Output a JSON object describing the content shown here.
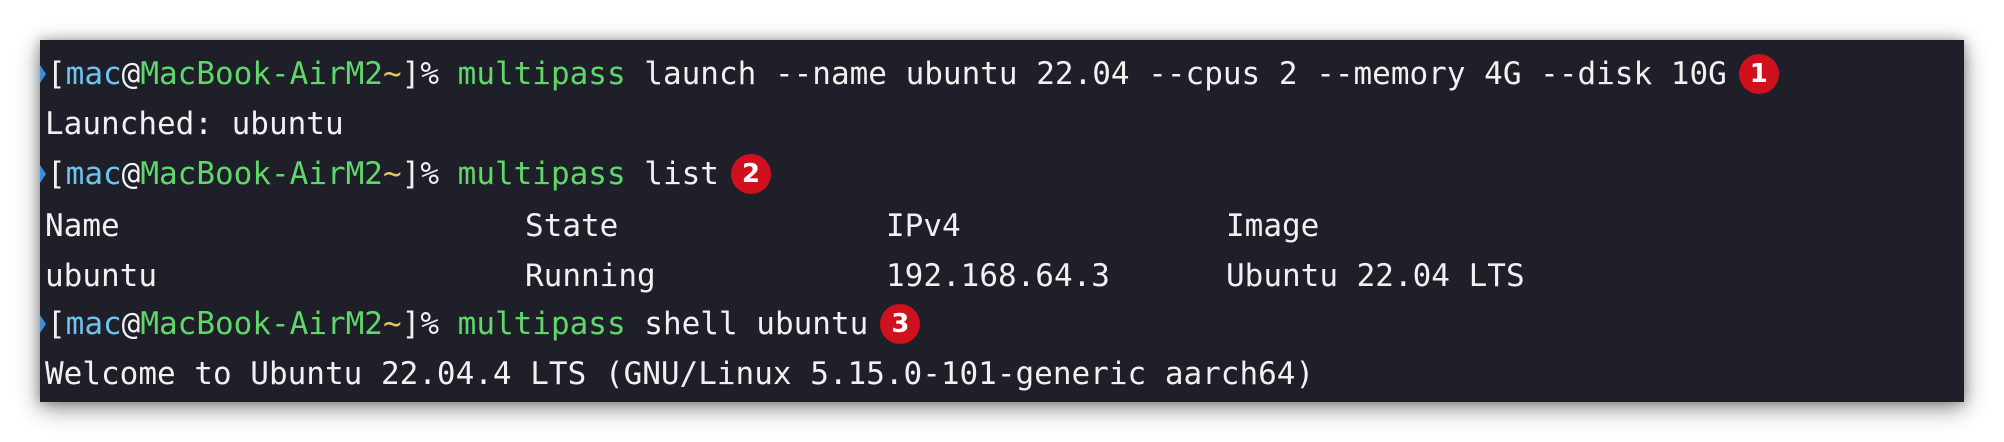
{
  "prompt": {
    "open_bracket": "[",
    "user": "mac",
    "at": "@",
    "host": "MacBook-AirM2",
    "tilde": "~",
    "close_bracket": "]",
    "symbol": "% "
  },
  "commands": [
    {
      "program": "multipass",
      "args": " launch --name ubuntu 22.04 --cpus 2 --memory 4G --disk 10G",
      "step": "1"
    },
    {
      "program": "multipass",
      "args": " list",
      "step": "2"
    },
    {
      "program": "multipass",
      "args": " shell ubuntu",
      "step": "3"
    }
  ],
  "outputs": {
    "launch": "Launched: ubuntu",
    "welcome": "Welcome to Ubuntu 22.04.4 LTS (GNU/Linux 5.15.0-101-generic aarch64)"
  },
  "list_table": {
    "headers": [
      "Name",
      "State",
      "IPv4",
      "Image"
    ],
    "rows": [
      [
        "ubuntu",
        "Running",
        "192.168.64.3",
        "Ubuntu 22.04 LTS"
      ]
    ]
  },
  "colors": {
    "terminal_bg": "#1f1f29",
    "command_green": "#5fd86a",
    "user_blue": "#6ec3f0",
    "tilde_yellow": "#e6c65a",
    "badge_red": "#d0101c"
  },
  "icons": {
    "prompt_marker": "chevron-right-icon"
  }
}
